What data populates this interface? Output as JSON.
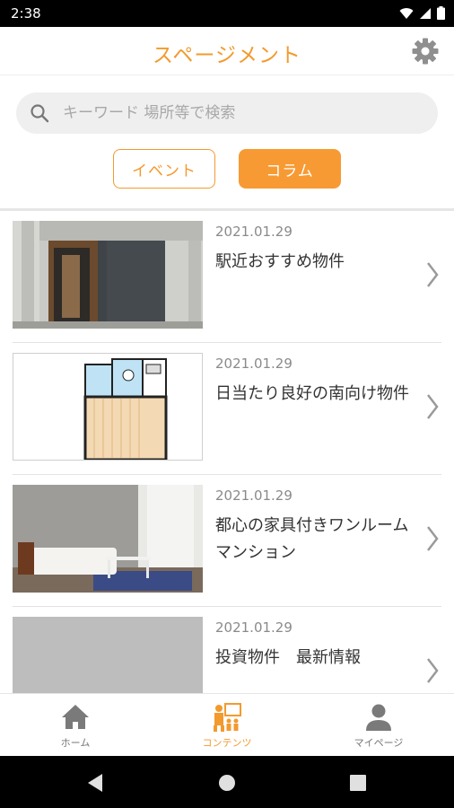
{
  "status_bar": {
    "time": "2:38"
  },
  "header": {
    "title": "スページメント",
    "settings_icon": "gear-icon"
  },
  "search": {
    "placeholder": "キーワード 場所等で検索",
    "value": ""
  },
  "filters": {
    "event_label": "イベント",
    "column_label": "コラム",
    "active": "column"
  },
  "articles": [
    {
      "date": "2021.01.29",
      "title": "駅近おすすめ物件",
      "thumbnail": "building-entrance-photo"
    },
    {
      "date": "2021.01.29",
      "title": "日当たり良好の南向け物件",
      "thumbnail": "floor-plan-image"
    },
    {
      "date": "2021.01.29",
      "title": "都心の家具付きワンルームマンション",
      "thumbnail": "furnished-room-photo"
    },
    {
      "date": "2021.01.29",
      "title": "投資物件　最新情報",
      "thumbnail": "placeholder-image"
    }
  ],
  "tabbar": [
    {
      "label": "ホーム",
      "icon": "home-icon"
    },
    {
      "label": "コンテンツ",
      "icon": "contents-icon",
      "active": true
    },
    {
      "label": "マイページ",
      "icon": "person-icon"
    }
  ],
  "colors": {
    "accent": "#f39a2e",
    "accent_fill": "#f79a33",
    "tab_inactive": "#777777"
  }
}
